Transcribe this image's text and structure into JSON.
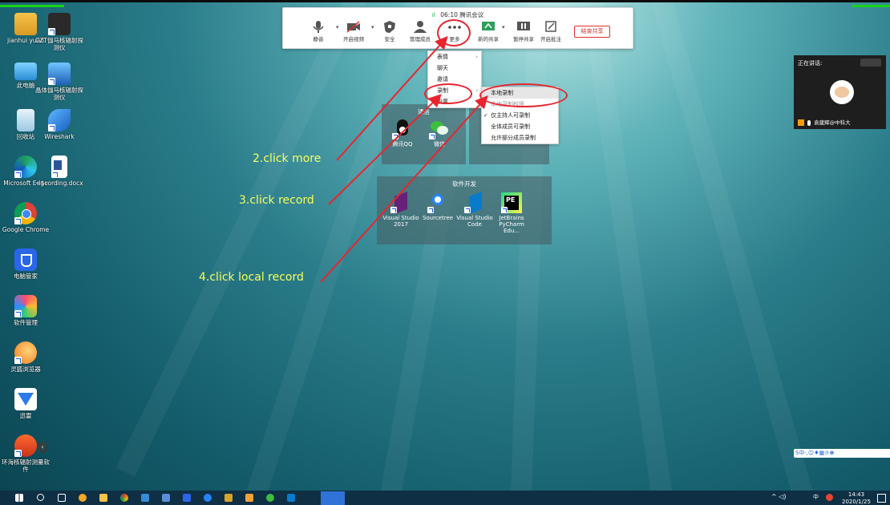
{
  "desktop": {
    "icons": [
      {
        "label": "jianhui yuan"
      },
      {
        "label": "CZT伽马核辐射探测仪"
      },
      {
        "label": "此电脑"
      },
      {
        "label": "晶体伽马核辐射探测仪"
      },
      {
        "label": "回收站"
      },
      {
        "label": "Wireshark"
      },
      {
        "label": "Microsoft Edge"
      },
      {
        "label": "~$cording.docx"
      },
      {
        "label": "Google Chrome"
      },
      {
        "label": "电脑管家"
      },
      {
        "label": "软件管理"
      },
      {
        "label": "灵狐浏览器"
      },
      {
        "label": "迅雷"
      },
      {
        "label": "环海核辐射测量软件"
      }
    ]
  },
  "toolbar": {
    "signal": "ıl",
    "time": "06:10",
    "app_title": "腾讯会议",
    "buttons": {
      "mute": "静音",
      "video": "开启视频",
      "security": "安全",
      "members": "管理成员",
      "more": "更多",
      "new_share": "新的共享",
      "pause_share": "暂停共享",
      "annotate": "开启批注"
    },
    "end_share": "结束共享"
  },
  "more_menu": {
    "items": [
      {
        "label": "表情",
        "has_submenu": true
      },
      {
        "label": "聊天",
        "has_submenu": false
      },
      {
        "label": "邀请",
        "has_submenu": false
      },
      {
        "label": "录制",
        "has_submenu": true
      },
      {
        "label": "设置",
        "has_submenu": false
      }
    ]
  },
  "record_menu": {
    "items": [
      {
        "label": "本地录制",
        "highlighted": true
      },
      {
        "label": "本地录制权限",
        "disabled": true
      },
      {
        "label": "仅主持人可录制",
        "checked": true
      },
      {
        "label": "全体成员可录制"
      },
      {
        "label": "允许部分成员录制"
      }
    ]
  },
  "groups": {
    "comm": {
      "title": "通信",
      "apps": [
        "腾讯QQ",
        "微信"
      ]
    },
    "dev": {
      "title": "软件开发",
      "apps": [
        "Visual Studio 2017",
        "Sourcetree",
        "Visual Studio Code",
        "JetBrains PyCharm Edu..."
      ]
    }
  },
  "annotations": {
    "step2": "2.click more",
    "step3": "3.click record",
    "step4": "4.click local record"
  },
  "speaker_panel": {
    "header": "正在讲话:",
    "name": "袁建辉@中科大"
  },
  "ime_bar": {
    "text": "S中·,☺♦▦♔♚"
  },
  "taskbar": {
    "clock_time": "14:43",
    "clock_date": "2020/1/25",
    "ime_indicator": "中"
  },
  "colors": {
    "annotation_text": "#f6ff5a",
    "annotation_ring": "#e8252f",
    "end_share": "#e03030",
    "signal_green": "#22b14c",
    "taskbar": "#0e2f44"
  }
}
